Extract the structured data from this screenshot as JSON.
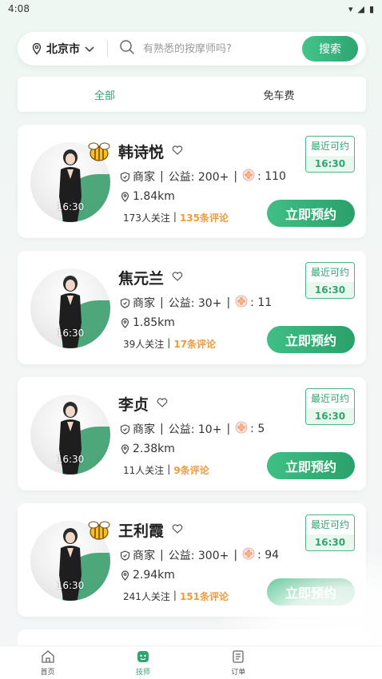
{
  "status_bar": {
    "time": "4:08"
  },
  "search": {
    "city": "北京市",
    "placeholder": "有熟悉的按摩师吗?",
    "button_label": "搜索"
  },
  "tabs": [
    {
      "label": "全部",
      "active": true
    },
    {
      "label": "免车费",
      "active": false
    }
  ],
  "therapists": [
    {
      "name": "韩诗悦",
      "merchant": "商家",
      "charity": "公益: 200+",
      "flower_count": ": 110",
      "distance": "1.84km",
      "followers": "173人关注",
      "reviews": "135条评论",
      "avatar_time": "16:30",
      "avail_label": "最近可约",
      "avail_time": "16:30",
      "book_label": "立即预约",
      "has_bee_badge": true
    },
    {
      "name": "焦元兰",
      "merchant": "商家",
      "charity": "公益: 30+",
      "flower_count": ": 11",
      "distance": "1.85km",
      "followers": "39人关注",
      "reviews": "17条评论",
      "avatar_time": "16:30",
      "avail_label": "最近可约",
      "avail_time": "16:30",
      "book_label": "立即预约",
      "has_bee_badge": false
    },
    {
      "name": "李贞",
      "merchant": "商家",
      "charity": "公益: 10+",
      "flower_count": ": 5",
      "distance": "2.38km",
      "followers": "11人关注",
      "reviews": "9条评论",
      "avatar_time": "16:30",
      "avail_label": "最近可约",
      "avail_time": "16:30",
      "book_label": "立即预约",
      "has_bee_badge": false
    },
    {
      "name": "王利霞",
      "merchant": "商家",
      "charity": "公益: 300+",
      "flower_count": ": 94",
      "distance": "2.94km",
      "followers": "241人关注",
      "reviews": "151条评论",
      "avatar_time": "16:30",
      "avail_label": "最近可约",
      "avail_time": "16:30",
      "book_label": "立即预约",
      "has_bee_badge": true
    }
  ],
  "bottom_nav": [
    {
      "label": "首页",
      "icon": "home-icon",
      "active": false
    },
    {
      "label": "技师",
      "icon": "therapist-icon",
      "active": true
    },
    {
      "label": "订单",
      "icon": "orders-icon",
      "active": false
    }
  ],
  "colors": {
    "accent": "#2fa572",
    "review": "#f09a3e"
  }
}
